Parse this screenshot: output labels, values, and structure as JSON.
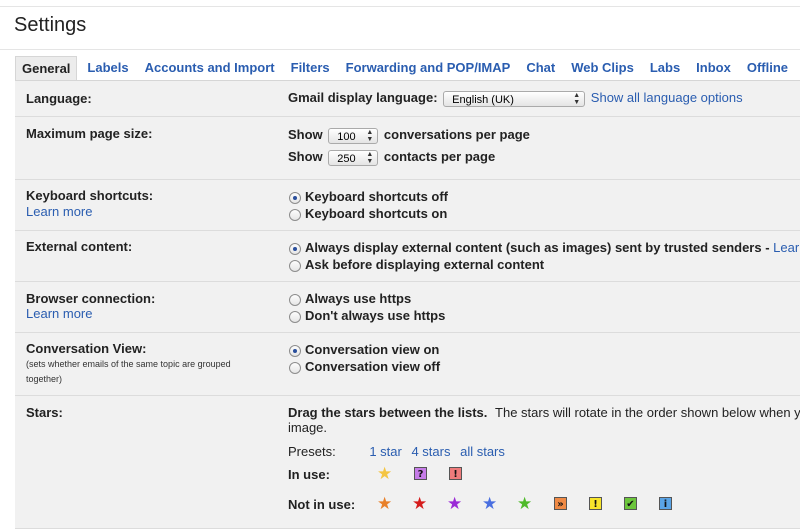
{
  "page": {
    "title": "Settings"
  },
  "tabs": [
    {
      "label": "General",
      "active": true
    },
    {
      "label": "Labels"
    },
    {
      "label": "Accounts and Import"
    },
    {
      "label": "Filters"
    },
    {
      "label": "Forwarding and POP/IMAP"
    },
    {
      "label": "Chat"
    },
    {
      "label": "Web Clips"
    },
    {
      "label": "Labs"
    },
    {
      "label": "Inbox"
    },
    {
      "label": "Offline"
    }
  ],
  "language": {
    "label": "Language:",
    "display_label": "Gmail display language:",
    "selected": "English (UK)",
    "show_all": "Show all language options"
  },
  "page_size": {
    "label": "Maximum page size:",
    "show": "Show",
    "conversations_value": "100",
    "conversations_suffix": "conversations per page",
    "contacts_value": "250",
    "contacts_suffix": "contacts per page"
  },
  "keyboard": {
    "label": "Keyboard shortcuts:",
    "learn_more": "Learn more",
    "off": "Keyboard shortcuts off",
    "on": "Keyboard shortcuts on",
    "selected": "off"
  },
  "external": {
    "label": "External content:",
    "always": "Always display external content (such as images) sent by trusted senders -",
    "learn_more": "Learn more",
    "ask": "Ask before displaying external content",
    "selected": "always"
  },
  "browser": {
    "label": "Browser connection:",
    "learn_more": "Learn more",
    "always_https": "Always use https",
    "dont_https": "Don't always use https",
    "selected": "none"
  },
  "conversation": {
    "label": "Conversation View:",
    "note": "(sets whether emails of the same topic are grouped together)",
    "on": "Conversation view on",
    "off": "Conversation view off",
    "selected": "on"
  },
  "stars": {
    "label": "Stars:",
    "drag_bold": "Drag the stars between the lists.",
    "drag_rest": "The stars will rotate in the order shown below when you click successively. To learn the name of a star for search, hover your mouse over the",
    "drag_line2": "image.",
    "presets_label": "Presets:",
    "preset_1": "1 star",
    "preset_4": "4 stars",
    "preset_all": "all stars",
    "in_use_label": "In use:",
    "not_in_use_label": "Not in use:",
    "in_use": [
      {
        "icon": "yellow-star-icon",
        "glyph": "★",
        "color": "#f4c542"
      },
      {
        "icon": "purple-question-icon",
        "glyph": "?",
        "color": "#c67ce8"
      },
      {
        "icon": "red-bang-icon",
        "glyph": "!",
        "color": "#ee7b7b"
      }
    ],
    "not_in_use": [
      {
        "icon": "orange-star-icon",
        "glyph": "★",
        "color": "#e8802a"
      },
      {
        "icon": "red-star-icon",
        "glyph": "★",
        "color": "#d51c1c"
      },
      {
        "icon": "purple-star-icon",
        "glyph": "★",
        "color": "#9a2ad6"
      },
      {
        "icon": "blue-star-icon",
        "glyph": "★",
        "color": "#4a6fe0"
      },
      {
        "icon": "green-star-icon",
        "glyph": "★",
        "color": "#4fba2a"
      },
      {
        "icon": "orange-guillemet-icon",
        "glyph": "»",
        "color": "#f08a45"
      },
      {
        "icon": "yellow-bang-icon",
        "glyph": "!",
        "color": "#f7e52b"
      },
      {
        "icon": "green-check-icon",
        "glyph": "✔",
        "color": "#6cc53c"
      },
      {
        "icon": "blue-info-icon",
        "glyph": "i",
        "color": "#5aa4e6"
      }
    ]
  }
}
